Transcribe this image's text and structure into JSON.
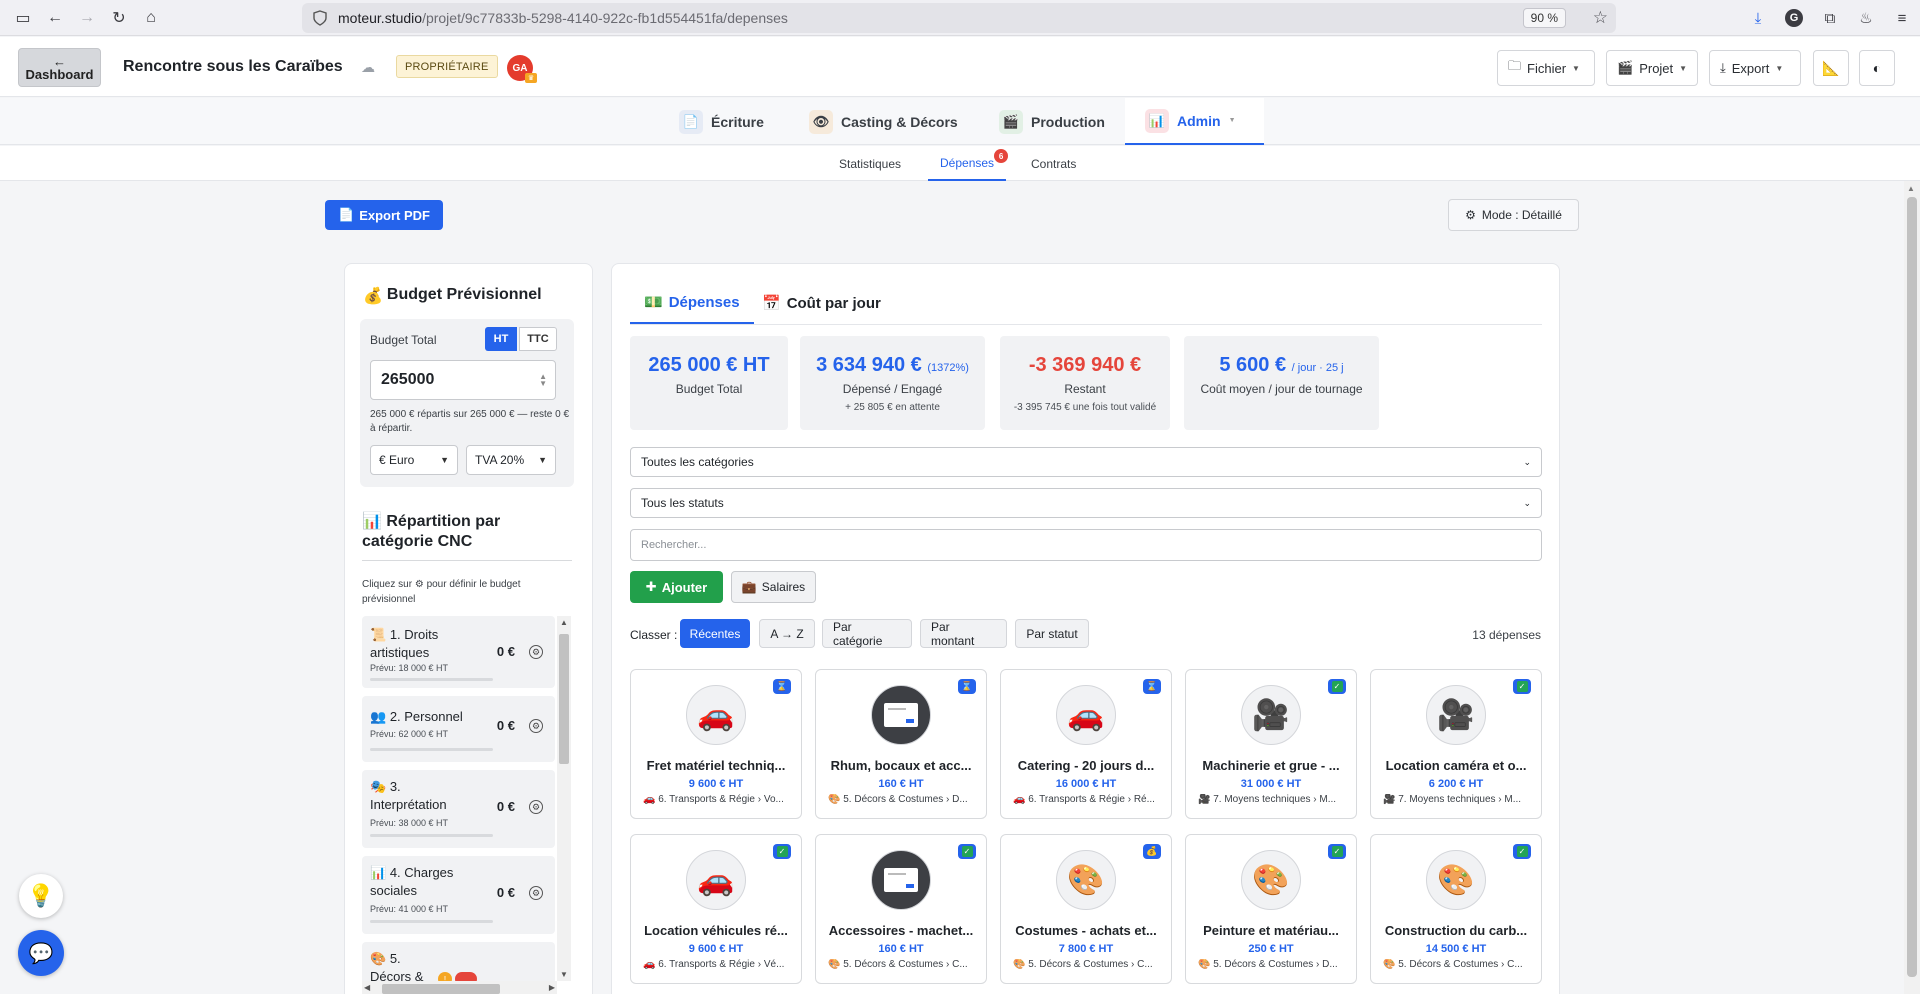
{
  "browser": {
    "url_host": "moteur.studio",
    "url_path": "/projet/9c77833b-5298-4140-922c-fb1d554451fa/depenses",
    "zoom": "90 %"
  },
  "header": {
    "dashboard_label": "Dashboard",
    "dashboard_arrow": "←",
    "project_title": "Rencontre sous les Caraïbes",
    "owner_badge": "PROPRIÉTAIRE",
    "user_initials": "GA",
    "fichier_label": "Fichier",
    "projet_label": "Projet",
    "export_label": "Export"
  },
  "main_tabs": [
    {
      "label": "Écriture"
    },
    {
      "label": "Casting & Décors"
    },
    {
      "label": "Production"
    },
    {
      "label": "Admin"
    }
  ],
  "sub_tabs": [
    {
      "label": "Statistiques"
    },
    {
      "label": "Dépenses",
      "badge": "6"
    },
    {
      "label": "Contrats"
    }
  ],
  "toolbar": {
    "export_pdf": "Export PDF",
    "mode": "Mode : Détaillé"
  },
  "budget": {
    "title": "Budget Prévisionnel",
    "total_label": "Budget Total",
    "ht": "HT",
    "ttc": "TTC",
    "value": "265000",
    "note": "265 000 € répartis sur 265 000 € — reste 0 € à répartir.",
    "currency": "€ Euro",
    "tva": "TVA 20%"
  },
  "repartition": {
    "title": "Répartition par catégorie CNC",
    "note_before": "Cliquez sur",
    "note_after": "pour définir le budget prévisionnel",
    "categories": [
      {
        "icon": "📜",
        "name": "1. Droits artistiques",
        "value": "0 €",
        "prevu": "Prévu: 18 000 € HT"
      },
      {
        "icon": "👥",
        "name": "2. Personnel",
        "value": "0 €",
        "prevu": "Prévu: 62 000 € HT"
      },
      {
        "icon": "🎭",
        "name": "3. Interprétation",
        "value": "0 €",
        "prevu": "Prévu: 38 000 € HT"
      },
      {
        "icon": "📊",
        "name": "4. Charges sociales",
        "value": "0 €",
        "prevu": "Prévu: 41 000 € HT"
      },
      {
        "icon": "🎨",
        "name": "5. Décors &",
        "value": "",
        "prevu": ""
      }
    ]
  },
  "expenses_tabs": [
    {
      "label": "Dépenses"
    },
    {
      "label": "Coût par jour"
    }
  ],
  "stats": [
    {
      "big": "265 000 € HT",
      "small": "",
      "label": "Budget Total",
      "sub": ""
    },
    {
      "big": "3 634 940 €",
      "small": "(1372%)",
      "label": "Dépensé / Engagé",
      "sub": "+ 25 805 € en attente"
    },
    {
      "big": "-3 369 940 €",
      "small": "",
      "label": "Restant",
      "sub": "-3 395 745 € une fois tout validé"
    },
    {
      "big": "5 600 €",
      "small": "/ jour · 25 j",
      "label": "Coût moyen / jour de tournage",
      "sub": ""
    }
  ],
  "filters": {
    "categories": "Toutes les catégories",
    "statuts": "Tous les statuts",
    "search_placeholder": "Rechercher..."
  },
  "actions": {
    "add": "Ajouter",
    "salaires": "Salaires"
  },
  "sort": {
    "label": "Classer :",
    "options": [
      "Récentes",
      "A → Z",
      "Par catégorie",
      "Par montant",
      "Par statut"
    ],
    "count": "13 dépenses"
  },
  "cards": [
    {
      "icon": "🚗",
      "title": "Fret matériel techniq...",
      "amount": "9 600 € HT",
      "cat_icon": "🚗",
      "category": "6. Transports & Régie › Vo...",
      "status": "pending"
    },
    {
      "icon": "shot",
      "title": "Rhum, bocaux et acc...",
      "amount": "160 € HT",
      "cat_icon": "🎨",
      "category": "5. Décors & Costumes › D...",
      "status": "pending"
    },
    {
      "icon": "🚗",
      "title": "Catering - 20 jours d...",
      "amount": "16 000 € HT",
      "cat_icon": "🚗",
      "category": "6. Transports & Régie › Ré...",
      "status": "pending"
    },
    {
      "icon": "🎥",
      "title": "Machinerie et grue - ...",
      "amount": "31 000 € HT",
      "cat_icon": "🎥",
      "category": "7. Moyens techniques › M...",
      "status": "done"
    },
    {
      "icon": "🎥",
      "title": "Location caméra et o...",
      "amount": "6 200 € HT",
      "cat_icon": "🎥",
      "category": "7. Moyens techniques › M...",
      "status": "done"
    },
    {
      "icon": "🚗",
      "title": "Location véhicules ré...",
      "amount": "9 600 € HT",
      "cat_icon": "🚗",
      "category": "6. Transports & Régie › Vé...",
      "status": "done"
    },
    {
      "icon": "shot",
      "title": "Accessoires - machet...",
      "amount": "160 € HT",
      "cat_icon": "🎨",
      "category": "5. Décors & Costumes › C...",
      "status": "done"
    },
    {
      "icon": "🎨",
      "title": "Costumes - achats et...",
      "amount": "7 800 € HT",
      "cat_icon": "🎨",
      "category": "5. Décors & Costumes › C...",
      "status": "paid"
    },
    {
      "icon": "🎨",
      "title": "Peinture et matériau...",
      "amount": "250 € HT",
      "cat_icon": "🎨",
      "category": "5. Décors & Costumes › D...",
      "status": "done"
    },
    {
      "icon": "🎨",
      "title": "Construction du carb...",
      "amount": "14 500 € HT",
      "cat_icon": "🎨",
      "category": "5. Décors & Costumes › C...",
      "status": "done"
    }
  ]
}
